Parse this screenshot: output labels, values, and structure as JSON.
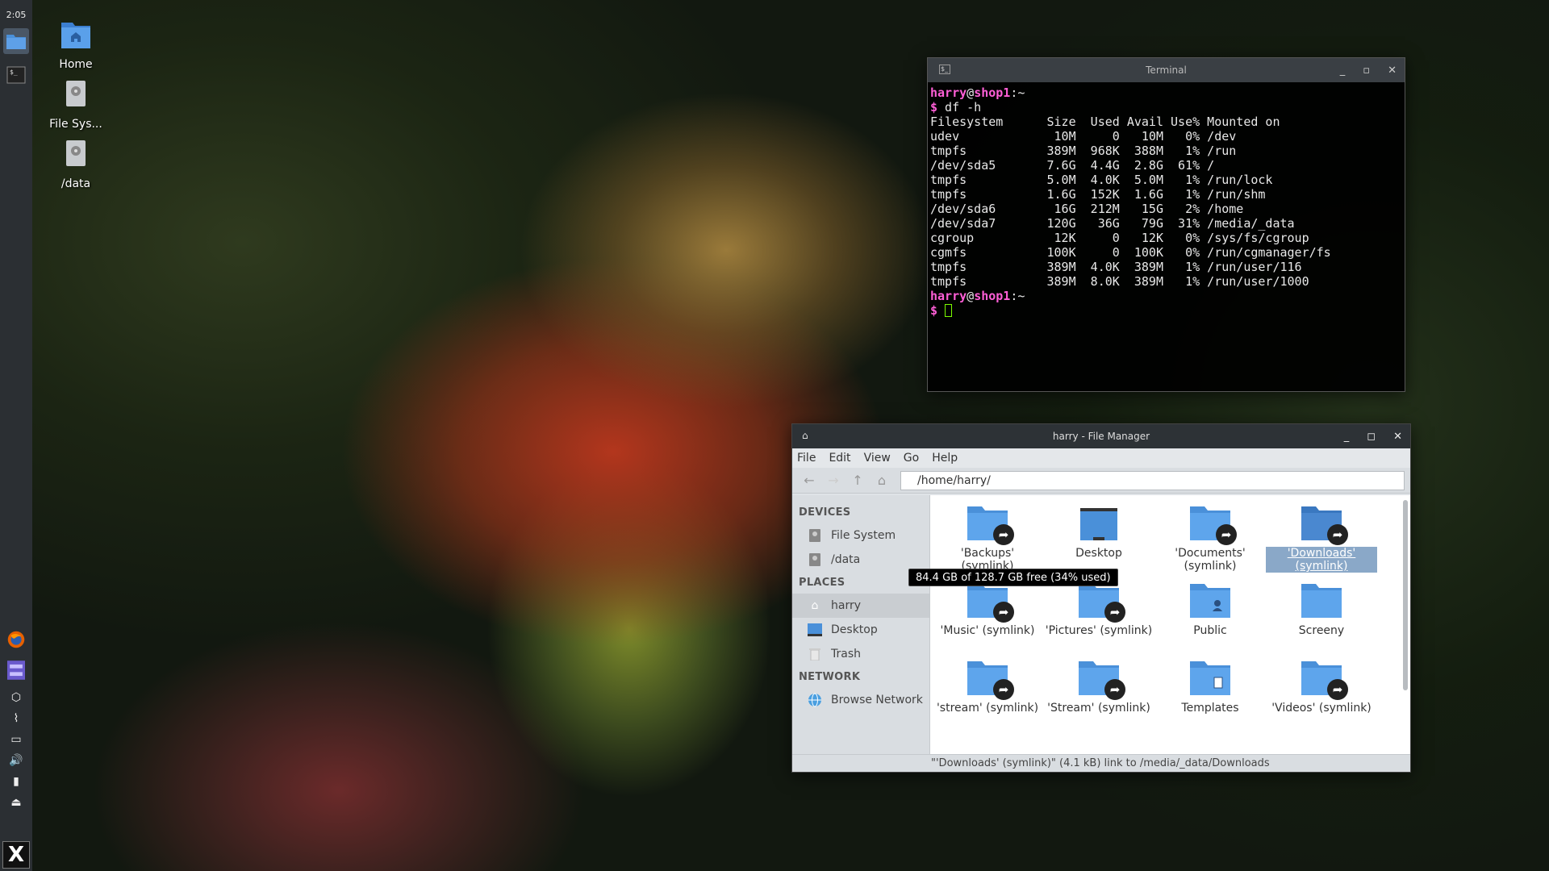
{
  "panel": {
    "clock": "2:05"
  },
  "desktop": {
    "icons": [
      {
        "label": "Home",
        "icon": "folder-home-icon"
      },
      {
        "label": "File Sys...",
        "icon": "drive-icon"
      },
      {
        "label": "/data",
        "icon": "drive-icon"
      }
    ]
  },
  "terminal": {
    "title": "Terminal",
    "prompt_user": "harry",
    "prompt_at": "@",
    "prompt_host": "shop1",
    "prompt_path": ":~",
    "prompt_dollar": "$",
    "command": " df -h",
    "header": "Filesystem      Size  Used Avail Use% Mounted on",
    "rows": [
      "udev             10M     0   10M   0% /dev",
      "tmpfs           389M  968K  388M   1% /run",
      "/dev/sda5       7.6G  4.4G  2.8G  61% /",
      "tmpfs           5.0M  4.0K  5.0M   1% /run/lock",
      "tmpfs           1.6G  152K  1.6G   1% /run/shm",
      "/dev/sda6        16G  212M   15G   2% /home",
      "/dev/sda7       120G   36G   79G  31% /media/_data",
      "cgroup           12K     0   12K   0% /sys/fs/cgroup",
      "cgmfs           100K     0  100K   0% /run/cgmanager/fs",
      "tmpfs           389M  4.0K  389M   1% /run/user/116",
      "tmpfs           389M  8.0K  389M   1% /run/user/1000"
    ]
  },
  "file_manager": {
    "title": "harry - File Manager",
    "menu": [
      "File",
      "Edit",
      "View",
      "Go",
      "Help"
    ],
    "address": "/home/harry/",
    "sidebar": {
      "devices_heading": "DEVICES",
      "devices": [
        "File System",
        "/data"
      ],
      "places_heading": "PLACES",
      "places": [
        "harry",
        "Desktop",
        "Trash"
      ],
      "network_heading": "NETWORK",
      "network": [
        "Browse Network"
      ]
    },
    "items": [
      {
        "label": "'Backups' (symlink)",
        "link": true
      },
      {
        "label": "Desktop",
        "link": false
      },
      {
        "label": "'Documents' (symlink)",
        "link": true
      },
      {
        "label": "'Downloads' (symlink)",
        "link": true,
        "selected": true
      },
      {
        "label": "'Music' (symlink)",
        "link": true
      },
      {
        "label": "'Pictures' (symlink)",
        "link": true
      },
      {
        "label": "Public",
        "link": false
      },
      {
        "label": "Screeny",
        "link": false
      },
      {
        "label": "'stream' (symlink)",
        "link": true
      },
      {
        "label": "'Stream' (symlink)",
        "link": true
      },
      {
        "label": "Templates",
        "link": false
      },
      {
        "label": "'Videos' (symlink)",
        "link": true
      }
    ],
    "tooltip": "84.4 GB of 128.7 GB free (34% used)",
    "status": "\"'Downloads' (symlink)\" (4.1 kB) link to /media/_data/Downloads"
  },
  "colors": {
    "folder_blue": "#4a90d9",
    "prompt_pink": "#ff5fd7",
    "selection": "#8aa8c8"
  }
}
